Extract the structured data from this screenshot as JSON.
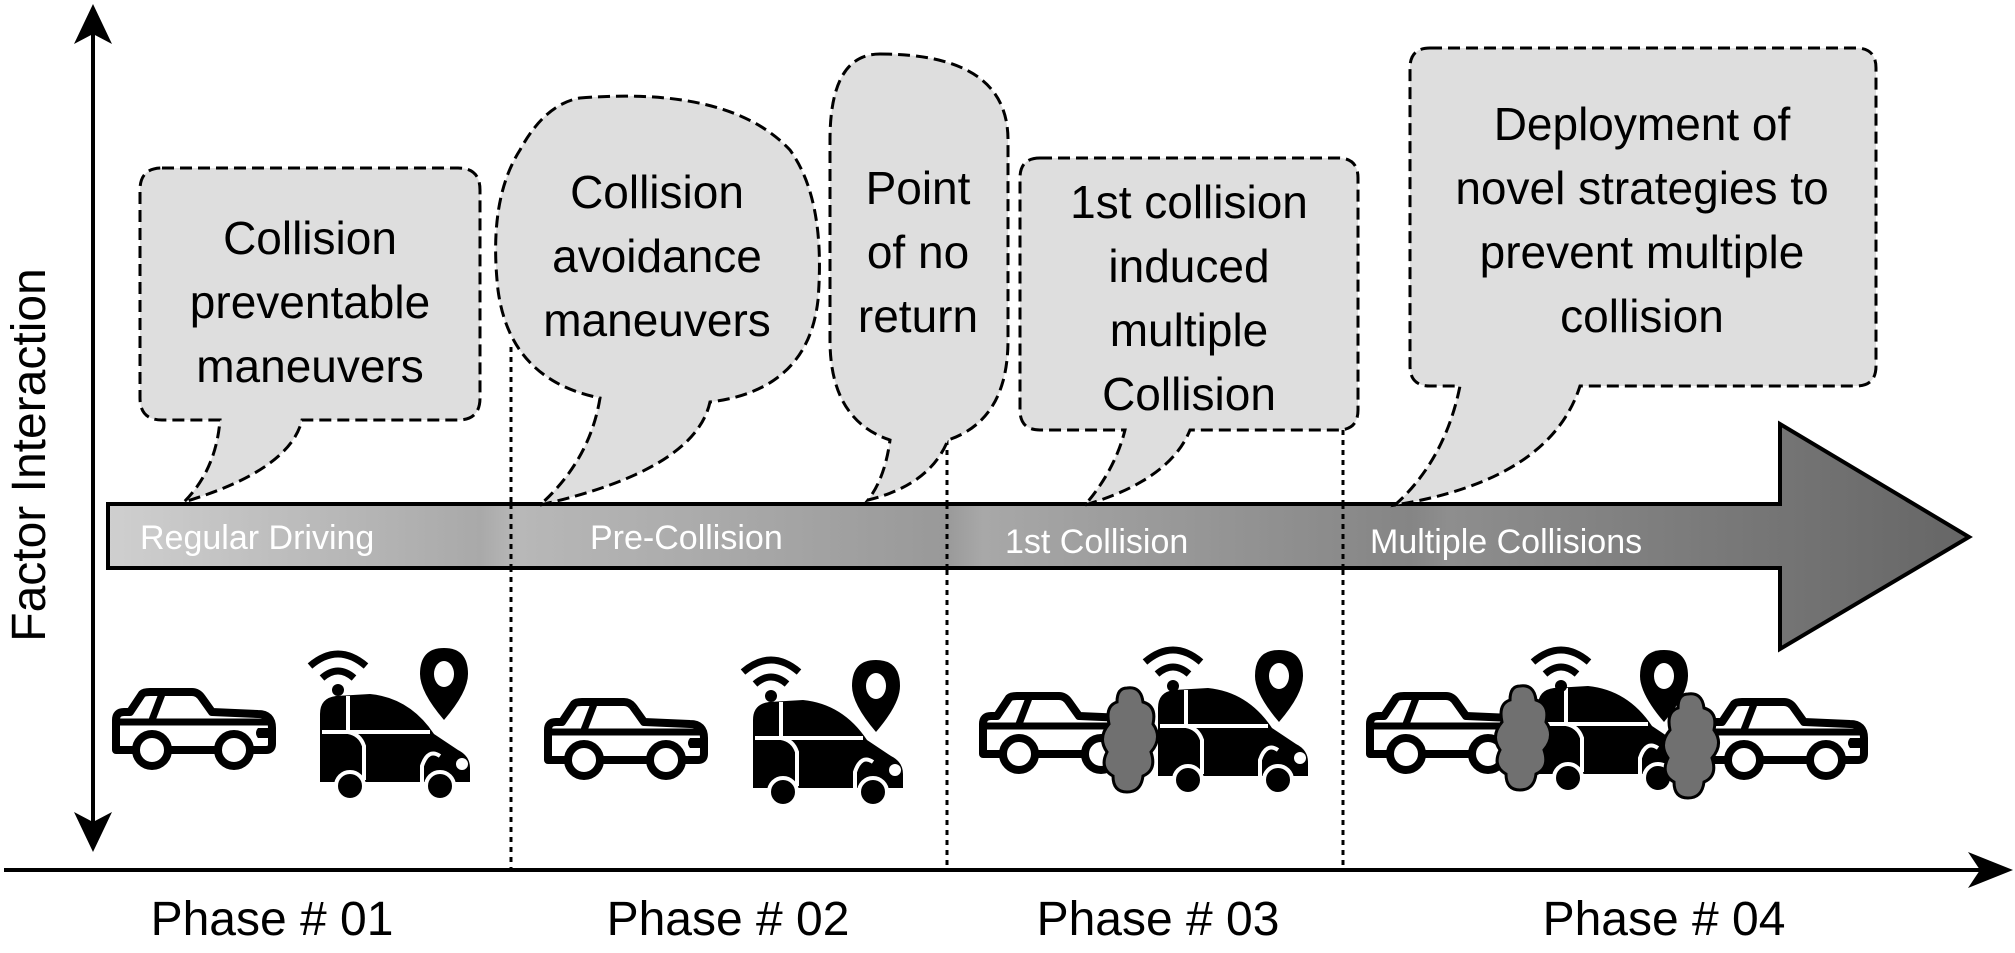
{
  "axes": {
    "y_label": "Factor Interaction"
  },
  "band": {
    "labels": [
      "Regular Driving",
      "Pre-Collision",
      "1st Collision",
      "Multiple Collisions"
    ]
  },
  "phases": [
    "Phase # 01",
    "Phase # 02",
    "Phase # 03",
    "Phase # 04"
  ],
  "bubbles": [
    {
      "lines": [
        "Collision",
        "preventable",
        "maneuvers"
      ]
    },
    {
      "lines": [
        "Collision",
        "avoidance",
        "maneuvers"
      ]
    },
    {
      "lines": [
        "Point",
        "of no",
        "return"
      ]
    },
    {
      "lines": [
        "1st collision",
        "induced",
        "multiple",
        "Collision"
      ]
    },
    {
      "lines": [
        "Deployment of",
        "novel strategies to",
        "prevent multiple",
        "collision"
      ]
    }
  ],
  "colors": {
    "bubble_fill": "#dedede",
    "band_light": "#c4c4c4",
    "band_dark": "#6e6e6e",
    "smoke": "#707070",
    "ink": "#000000"
  },
  "icons": {
    "phase1": [
      "car-outline-icon",
      "autonomous-car-icon",
      "wifi-icon",
      "location-pin-icon"
    ],
    "phase2": [
      "car-outline-icon",
      "autonomous-car-icon",
      "wifi-icon",
      "location-pin-icon"
    ],
    "phase3": [
      "car-outline-icon",
      "smoke-cloud-icon",
      "autonomous-car-icon",
      "wifi-icon",
      "location-pin-icon"
    ],
    "phase4": [
      "car-outline-icon",
      "smoke-cloud-icon",
      "autonomous-car-icon",
      "wifi-icon",
      "location-pin-icon",
      "smoke-cloud-icon",
      "car-outline-icon"
    ]
  }
}
